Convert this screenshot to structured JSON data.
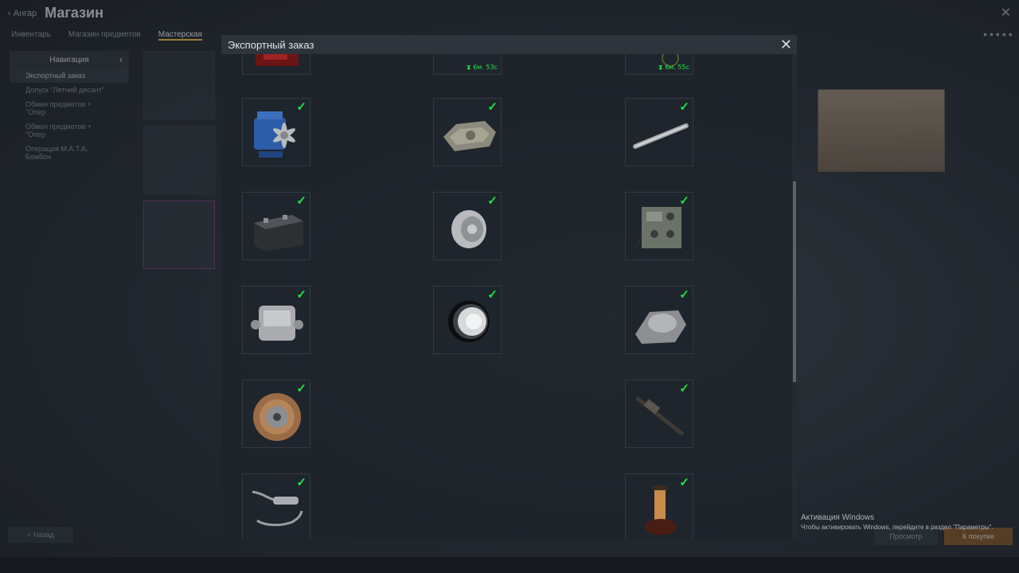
{
  "background": {
    "back_label": "Ангар",
    "title": "Магазин",
    "tabs": [
      "Инвентарь",
      "Магазин предметов",
      "Мастерская"
    ],
    "nav": {
      "header": "Навигация",
      "items": [
        "Экспортный заказ",
        "Допуск \"Летний десант\"",
        "Обмен предметов + \"Опер",
        "Обмен предметов + \"Опер",
        "Операция M.A.T.A. Бомбон"
      ]
    },
    "back_button": "< Назад",
    "preview_button": "Просмотр",
    "buy_button": "К покупке"
  },
  "modal": {
    "title": "Экспортный заказ",
    "close_icon": "close-icon",
    "items": [
      {
        "name": "red-part",
        "col": 0,
        "timer": ""
      },
      {
        "name": "unknown-part",
        "col": 1,
        "timer": "6м. 53с"
      },
      {
        "name": "unknown-part-2",
        "col": 2,
        "timer": "6м. 55с"
      },
      {
        "name": "engine",
        "col": 0,
        "checked": true
      },
      {
        "name": "tank-hull",
        "col": 1,
        "checked": true
      },
      {
        "name": "gun-barrel",
        "col": 2,
        "checked": true
      },
      {
        "name": "battery",
        "col": 0,
        "checked": true
      },
      {
        "name": "wheel-rim",
        "col": 1,
        "checked": true
      },
      {
        "name": "radio-station",
        "col": 2,
        "checked": true
      },
      {
        "name": "gearbox",
        "col": 0,
        "checked": true
      },
      {
        "name": "headlight",
        "col": 1,
        "checked": true
      },
      {
        "name": "armor-plate",
        "col": 2,
        "checked": true
      },
      {
        "name": "clutch-disc",
        "col": 0,
        "checked": true
      },
      {
        "name": "machine-gun",
        "col": 2,
        "checked": true
      },
      {
        "name": "exhaust-muffler",
        "col": 0,
        "checked": true
      },
      {
        "name": "fuel-filter",
        "col": 2,
        "checked": true
      }
    ],
    "check_mark": "✓"
  },
  "windows_activation": {
    "title": "Активация Windows",
    "subtitle": "Чтобы активировать Windows, перейдите в раздел \"Параметры\"."
  },
  "colors": {
    "check": "#25e043",
    "modal_header": "#2d343c"
  }
}
